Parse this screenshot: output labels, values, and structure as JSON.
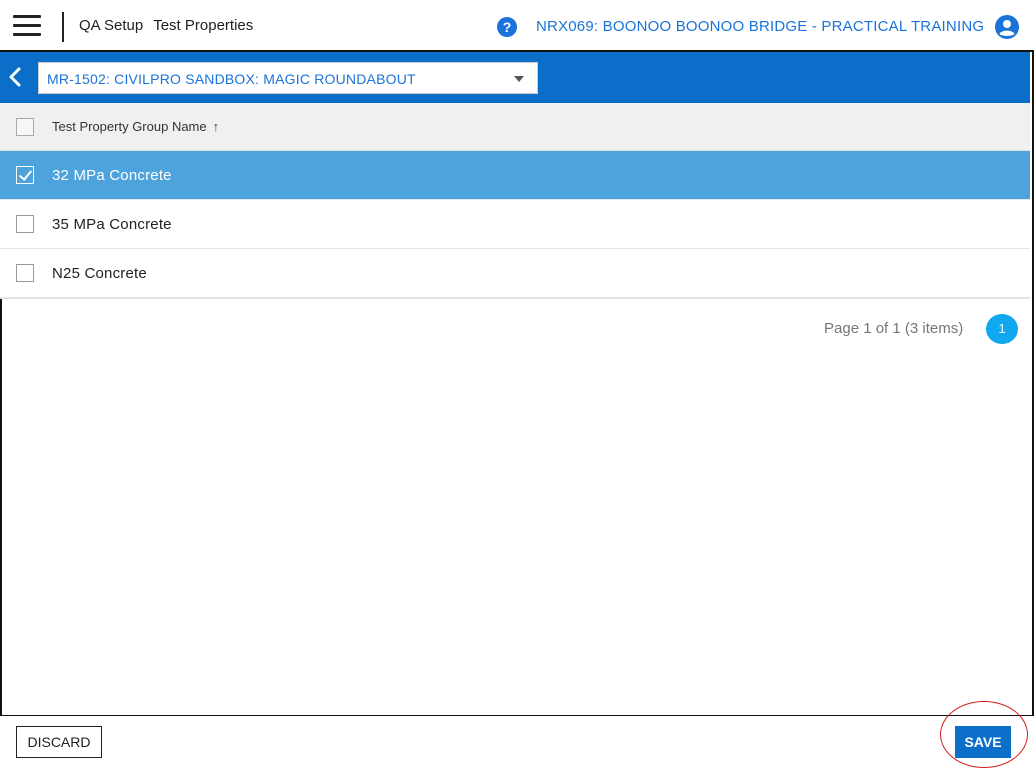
{
  "header": {
    "breadcrumb": [
      "QA Setup",
      "Test Properties"
    ],
    "project_title": "NRX069: BOONOO BOONOO BRIDGE - PRACTICAL TRAINING",
    "help_glyph": "?",
    "icons": {
      "menu": "hamburger-menu-icon",
      "help": "help-icon",
      "user": "user-account-icon"
    },
    "accent_color": "#1a73d9"
  },
  "context_bar": {
    "selected_context": "MR-1502: CIVILPRO SANDBOX: MAGIC ROUNDABOUT",
    "bar_color": "#0b6fca"
  },
  "grid": {
    "column_header": "Test Property Group Name",
    "sort_indicator": "↑",
    "rows": [
      {
        "label": "32 MPa Concrete",
        "selected": true
      },
      {
        "label": "35 MPa Concrete",
        "selected": false
      },
      {
        "label": "N25 Concrete",
        "selected": false
      }
    ],
    "selected_row_color": "#4da3db"
  },
  "pager": {
    "info": "Page 1 of 1 (3 items)",
    "current_page": "1"
  },
  "footer": {
    "discard_label": "DISCARD",
    "save_label": "SAVE"
  }
}
